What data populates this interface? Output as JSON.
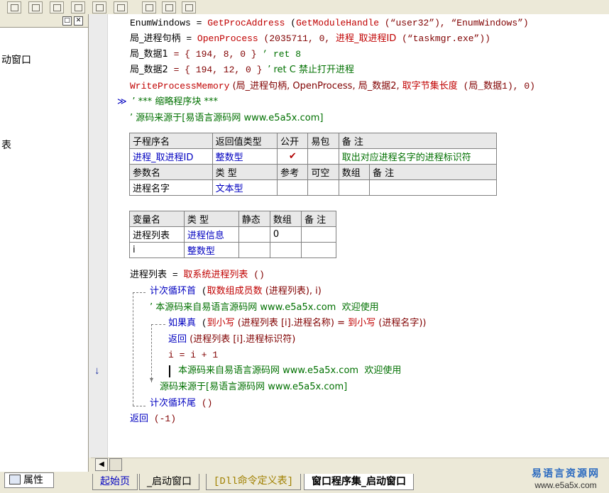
{
  "left_panel": {
    "item_window": "动窗口",
    "item_table": "表"
  },
  "code": {
    "l1": {
      "a": "EnumWindows",
      "b": " = ",
      "c": "GetProcAddress",
      "d": " (",
      "e": "GetModuleHandle",
      "f": " (“user32”), “EnumWindows”)"
    },
    "l2": {
      "a": "局_进程句柄",
      "b": " = ",
      "c": "OpenProcess",
      "d": " (2035711, 0, ",
      "e": "进程_取进程ID",
      "f": " (“taskmgr.exe”))"
    },
    "l3": {
      "a": "局_数据1",
      "b": " = { 194, 8, 0 } ",
      "c": "’ ret 8"
    },
    "l4": {
      "a": "局_数据2",
      "b": " = { 194, 12, 0 } ",
      "c": "’ ret C 禁止打开进程"
    },
    "l5": {
      "a": "WriteProcessMemory",
      "b": " (局_进程句柄, OpenProcess, 局_数据2, ",
      "c": "取字节集长度",
      "d": " (局_数据1), 0)"
    },
    "l6": {
      "marker": "≫",
      "text": "’ *** 缩略程序块 ***"
    },
    "l7": "’ 源码来源于[易语言源码网 www.e5a5x.com]"
  },
  "sub_table": {
    "headers": [
      "子程序名",
      "返回值类型",
      "公开",
      "易包",
      "备 注"
    ],
    "row": {
      "name": "进程_取进程ID",
      "type": "整数型",
      "public": "✔",
      "pack": "",
      "note": "取出对应进程名字的进程标识符"
    },
    "param_headers": [
      "参数名",
      "类 型",
      "参考",
      "可空",
      "数组",
      "备 注"
    ],
    "param_row": {
      "name": "进程名字",
      "type": "文本型"
    }
  },
  "var_table": {
    "headers": [
      "变量名",
      "类 型",
      "静态",
      "数组",
      "备 注"
    ],
    "rows": [
      {
        "name": "进程列表",
        "type": "进程信息",
        "static": "",
        "array": "0",
        "note": ""
      },
      {
        "name": "i",
        "type": "整数型",
        "static": "",
        "array": "",
        "note": ""
      }
    ]
  },
  "body": {
    "b1": {
      "a": "进程列表",
      "b": " = ",
      "c": "取系统进程列表",
      "d": " ()"
    },
    "b2": {
      "a": "计次循环首",
      "b": " (",
      "c": "取数组成员数",
      "d": " (进程列表), i)"
    },
    "b3": "’ 本源码来自易语言源码网 www.e5a5x.com  欢迎使用",
    "b4": {
      "a": "如果真",
      "b": " (",
      "c": "到小写",
      "d": " (进程列表 [i].进程名称) = ",
      "e": "到小写",
      "f": " (进程名字))"
    },
    "b5": {
      "a": "返回",
      "b": " (进程列表 [i].进程标识符)"
    },
    "b6": "i = i + 1",
    "b7": "本源码来自易语言源码网 www.e5a5x.com  欢迎使用",
    "b8": "源码来源于[易语言源码网 www.e5a5x.com]",
    "b9": {
      "a": "计次循环尾",
      "b": " ()"
    },
    "b10": {
      "a": "返回",
      "b": " (-1)"
    }
  },
  "tabs": {
    "attr": "属性",
    "t1": "起始页",
    "t2": "_启动窗口",
    "t3": "[Dll命令定义表]",
    "t4": "窗口程序集_启动窗口"
  },
  "watermark": {
    "line1": "易语言资源网",
    "line2": "www.e5a5x.com"
  },
  "colors": {
    "red": "#c00000",
    "blue": "#0000c0",
    "green": "#007000"
  }
}
